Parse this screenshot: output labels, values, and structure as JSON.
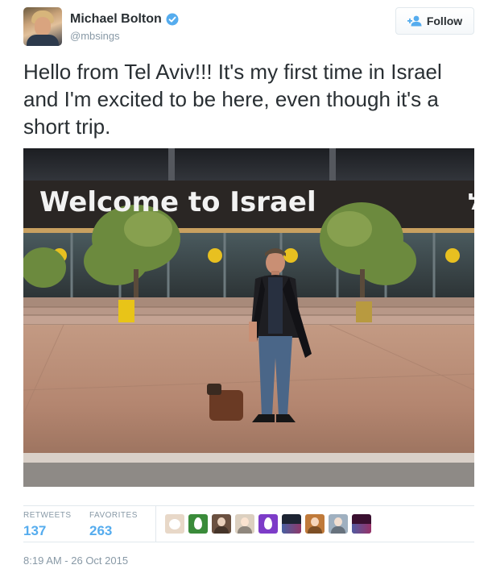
{
  "user": {
    "display_name": "Michael Bolton",
    "handle": "@mbsings",
    "verified": true
  },
  "follow_button": {
    "label": "Follow"
  },
  "tweet": {
    "text": "Hello from Tel Aviv!!! It's my first time in Israel and I'm excited to be here, even though it's a short trip."
  },
  "photo": {
    "sign_text_en": "Welcome to Israel",
    "sign_text_he": "ברוכים הבאים לישראל"
  },
  "stats": {
    "retweets_label": "RETWEETS",
    "retweets_value": "137",
    "favorites_label": "FAVORITES",
    "favorites_value": "263"
  },
  "favoriters": [
    {
      "color": "#e8d8c8",
      "icon": "dog-avatar"
    },
    {
      "color": "#3a8b3a",
      "icon": "egg-avatar"
    },
    {
      "color": "#6a5040",
      "icon": "person-avatar"
    },
    {
      "color": "#dcd0c0",
      "icon": "person-avatar"
    },
    {
      "color": "#7d3cc8",
      "icon": "egg-avatar"
    },
    {
      "color": "#1d2433",
      "icon": "scene-avatar"
    },
    {
      "color": "#c07a3a",
      "icon": "person-avatar"
    },
    {
      "color": "#9fb0c0",
      "icon": "person-avatar"
    },
    {
      "color": "#3a1030",
      "icon": "scene-avatar"
    }
  ],
  "timestamp": "8:19 AM - 26 Oct 2015",
  "colors": {
    "link_blue": "#55acee",
    "verified_blue": "#55acee",
    "text_gray": "#8899a6",
    "border": "#e1e8ed"
  }
}
